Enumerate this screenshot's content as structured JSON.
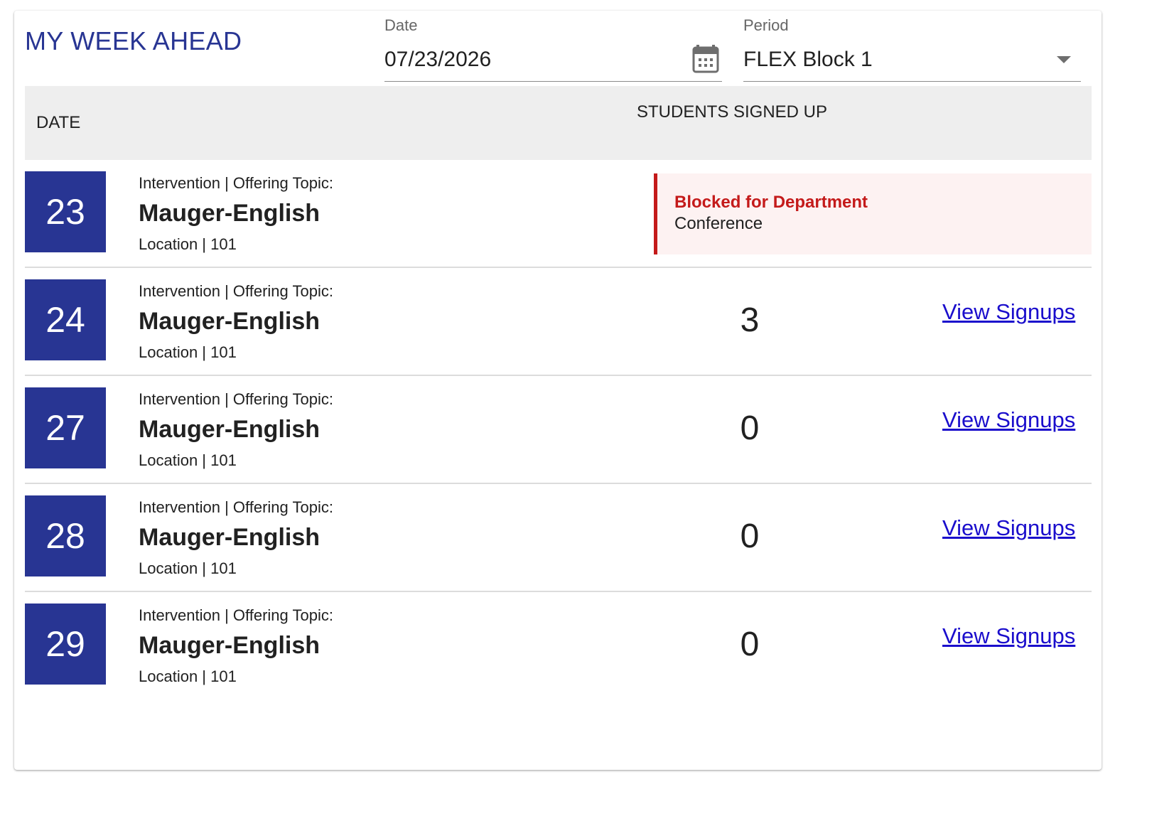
{
  "header": {
    "title": "MY WEEK AHEAD",
    "date_label": "Date",
    "date_value": "07/23/2026",
    "period_label": "Period",
    "period_value": "FLEX Block 1"
  },
  "table": {
    "col_date": "DATE",
    "col_students": "STUDENTS SIGNED UP"
  },
  "rows": [
    {
      "day": "23",
      "label": "Intervention | Offering Topic:",
      "topic": "Mauger-English",
      "location": "Location | 101",
      "blocked": true,
      "blocked_title": "Blocked for Department",
      "blocked_text": "Conference"
    },
    {
      "day": "24",
      "label": "Intervention | Offering Topic:",
      "topic": "Mauger-English",
      "location": "Location | 101",
      "count": "3",
      "link": "View Signups"
    },
    {
      "day": "27",
      "label": "Intervention | Offering Topic:",
      "topic": "Mauger-English",
      "location": "Location | 101",
      "count": "0",
      "link": "View Signups"
    },
    {
      "day": "28",
      "label": "Intervention | Offering Topic:",
      "topic": "Mauger-English",
      "location": "Location | 101",
      "count": "0",
      "link": "View Signups"
    },
    {
      "day": "29",
      "label": "Intervention | Offering Topic:",
      "topic": "Mauger-English",
      "location": "Location | 101",
      "count": "0",
      "link": "View Signups"
    }
  ],
  "icons": {
    "date_picker": "calendar-icon",
    "period_select": "chevron-down-icon"
  },
  "colors": {
    "accent": "#283593",
    "blocked": "#c41a1a",
    "blocked_bg": "#fdf2f2",
    "link": "#1a0dcc",
    "header_bg": "#eeeeee"
  }
}
